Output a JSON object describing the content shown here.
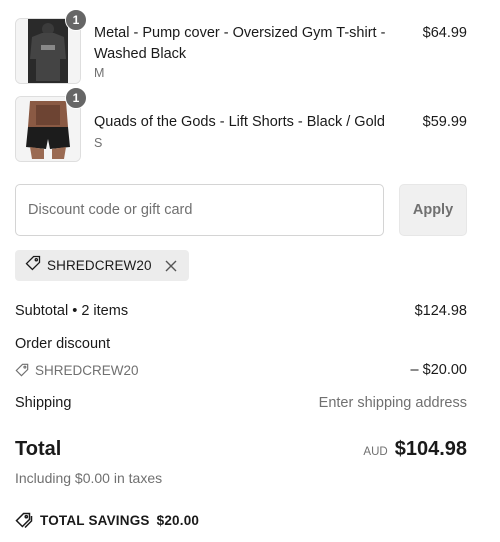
{
  "line_items": [
    {
      "quantity": "1",
      "title": "Metal - Pump cover - Oversized Gym T-shirt - Washed Black",
      "variant": "M",
      "price": "$64.99",
      "image_icon": "tshirt-product-image"
    },
    {
      "quantity": "1",
      "title": "Quads of the Gods - Lift Shorts - Black / Gold",
      "variant": "S",
      "price": "$59.99",
      "image_icon": "shorts-product-image"
    }
  ],
  "discount": {
    "placeholder": "Discount code or gift card",
    "value": "",
    "apply_label": "Apply",
    "applied_code": "SHREDCREW20"
  },
  "summary": {
    "subtotal_label": "Subtotal • 2 items",
    "subtotal_value": "$124.98",
    "order_discount_label": "Order discount",
    "order_discount_code": "SHREDCREW20",
    "order_discount_value": "– $20.00",
    "shipping_label": "Shipping",
    "shipping_value": "Enter shipping address",
    "total_label": "Total",
    "currency": "AUD",
    "total_value": "$104.98",
    "taxes_note": "Including $0.00 in taxes",
    "savings_label": "TOTAL SAVINGS",
    "savings_value": "$20.00"
  },
  "colors": {
    "text": "#1a1a1a",
    "muted": "#707070",
    "badge": "#666666",
    "chip_bg": "#ececec",
    "button_bg": "#f0f0f0"
  }
}
